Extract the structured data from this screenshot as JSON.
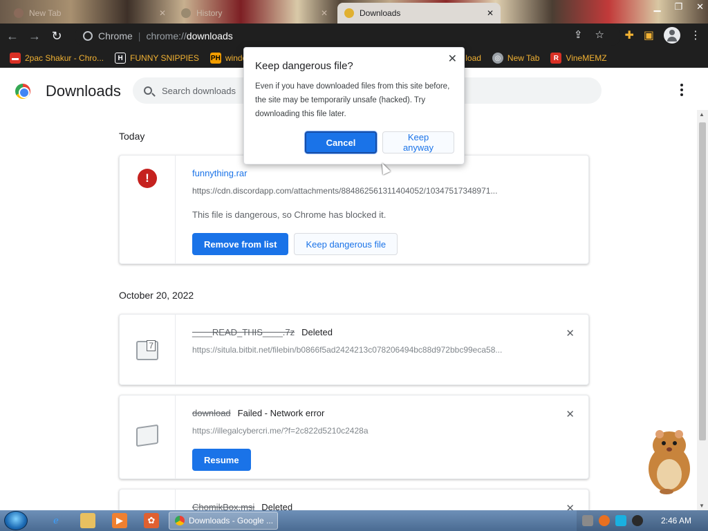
{
  "tabs": [
    {
      "title": "New Tab",
      "active": false
    },
    {
      "title": "History",
      "active": false
    },
    {
      "title": "Downloads",
      "active": true
    }
  ],
  "toolbar": {
    "chip_label": "Chrome",
    "url_scheme": "chrome://",
    "url_path": "downloads"
  },
  "bookmarks": [
    {
      "label": "2pac Shakur - Chro...",
      "icon": "bookmark-icon",
      "color": "#d93025"
    },
    {
      "label": "FUNNY SNIPPIES",
      "icon": "H",
      "color": "#202124"
    },
    {
      "label": "windo",
      "icon": "PH",
      "color": "#f29d00"
    },
    {
      "label": "load",
      "icon": "",
      "color": ""
    },
    {
      "label": "New Tab",
      "icon": "globe-icon",
      "color": "#5f6368"
    },
    {
      "label": "VineMEMZ",
      "icon": "R",
      "color": "#d93025"
    }
  ],
  "page": {
    "title": "Downloads",
    "search_placeholder": "Search downloads",
    "sections": [
      {
        "date": "Today"
      },
      {
        "date": "October 20, 2022"
      }
    ]
  },
  "downloads": [
    {
      "name": "funnything.rar",
      "url": "https://cdn.discordapp.com/attachments/884862561311404052/10347517348971...",
      "description": "This file is dangerous, so Chrome has blocked it.",
      "primary_action": "Remove from list",
      "secondary_action": "Keep dangerous file"
    },
    {
      "name": "____READ_THIS____.7z",
      "status": "Deleted",
      "url": "https://situla.bitbit.net/filebin/b0866f5ad2424213c078206494bc88d972bbc99eca58..."
    },
    {
      "name": "download",
      "status": "Failed - Network error",
      "url": "https://illegalcybercri.me/?f=2c822d5210c2428a",
      "primary_action": "Resume"
    },
    {
      "name": "ChomikBox.msi",
      "status": "Deleted"
    }
  ],
  "dialog": {
    "title": "Keep dangerous file?",
    "body": "Even if you have downloaded files from this site before, the site may be temporarily unsafe (hacked). Try downloading this file later.",
    "cancel_label": "Cancel",
    "keep_label": "Keep anyway"
  },
  "taskbar": {
    "task_label": "Downloads - Google ...",
    "clock": "2:46 AM"
  },
  "colors": {
    "accent": "#1a73e8",
    "danger": "#c5221f",
    "bookmark_text": "#f2b233"
  }
}
